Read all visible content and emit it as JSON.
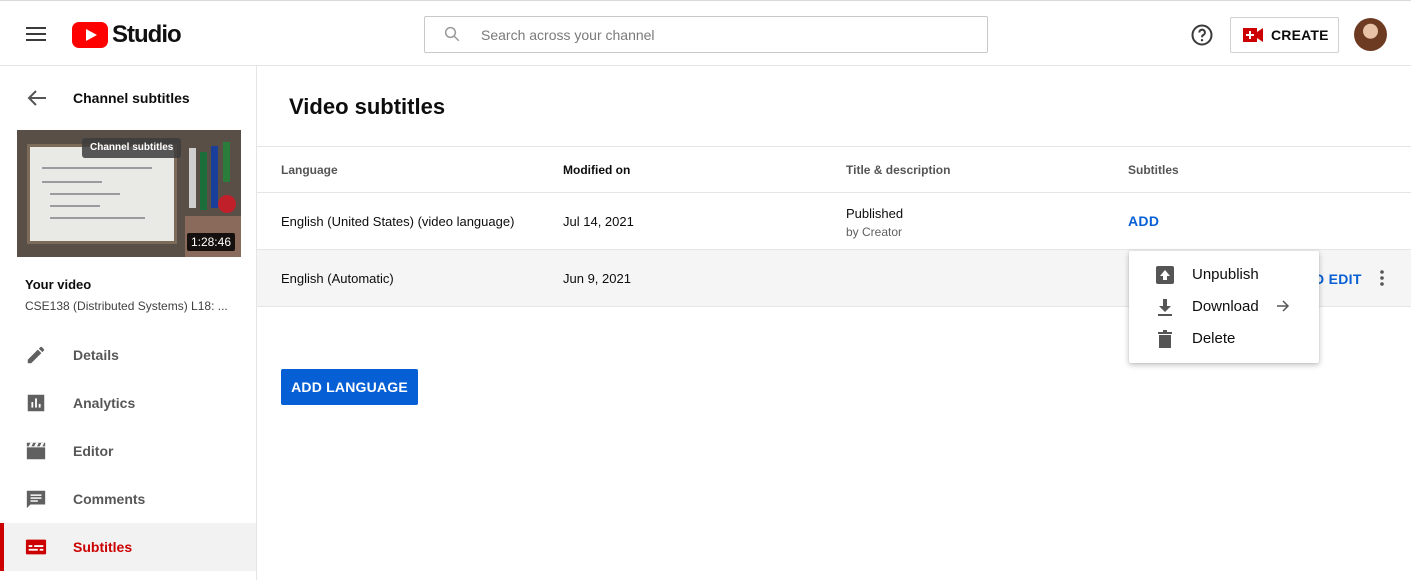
{
  "header": {
    "logo_text": "Studio",
    "search_placeholder": "Search across your channel",
    "create_label": "CREATE"
  },
  "sidebar": {
    "back_title": "Channel subtitles",
    "thumbnail_chip": "Channel subtitles",
    "thumbnail_duration": "1:28:46",
    "your_video_label": "Your video",
    "video_title": "CSE138 (Distributed Systems) L18: ...",
    "nav": [
      {
        "label": "Details",
        "icon": "pencil-icon"
      },
      {
        "label": "Analytics",
        "icon": "analytics-icon"
      },
      {
        "label": "Editor",
        "icon": "clapperboard-icon"
      },
      {
        "label": "Comments",
        "icon": "comment-icon"
      },
      {
        "label": "Subtitles",
        "icon": "subtitles-icon",
        "active": true
      }
    ]
  },
  "main": {
    "title": "Video subtitles",
    "columns": [
      "Language",
      "Modified on",
      "Title & description",
      "Subtitles"
    ],
    "rows": [
      {
        "language": "English (United States) (video language)",
        "modified": "Jul 14, 2021",
        "title_status": "Published",
        "title_by": "by Creator",
        "subtitles_action": "ADD"
      },
      {
        "language": "English (Automatic)",
        "modified": "Jun 9, 2021",
        "subtitles_action": "D EDIT"
      }
    ],
    "add_language_label": "ADD LANGUAGE"
  },
  "menu": {
    "items": [
      {
        "label": "Unpublish",
        "icon": "unpublish-icon"
      },
      {
        "label": "Download",
        "icon": "download-icon"
      },
      {
        "label": "Delete",
        "icon": "trash-icon"
      }
    ]
  },
  "colors": {
    "accent": "#065fd4",
    "brand": "#ff0000",
    "active_nav": "#cc0000"
  }
}
